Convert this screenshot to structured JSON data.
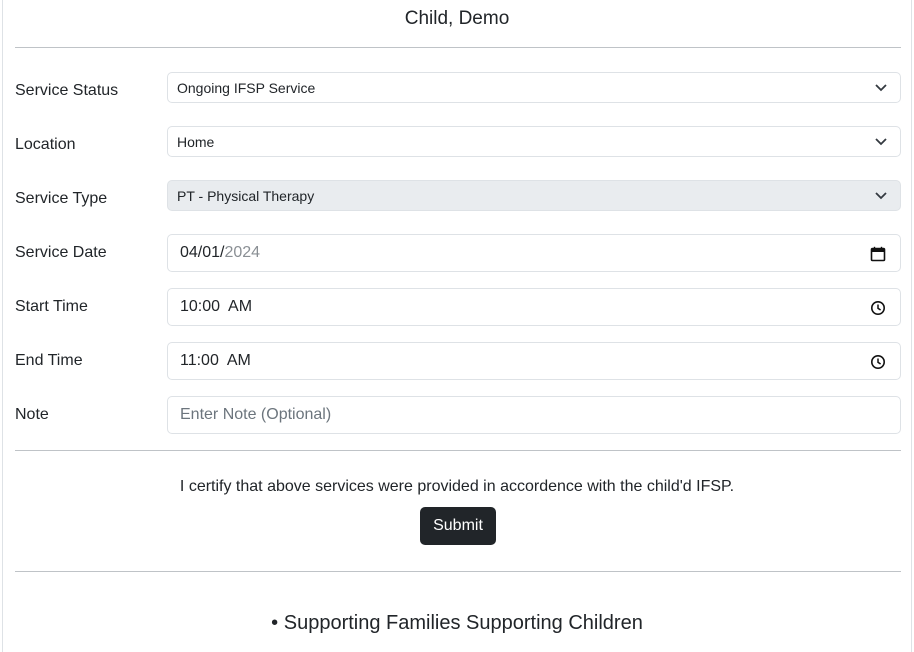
{
  "header": {
    "title": "Child, Demo"
  },
  "form": {
    "service_status": {
      "label": "Service Status",
      "value": "Ongoing IFSP Service"
    },
    "location": {
      "label": "Location",
      "value": "Home"
    },
    "service_type": {
      "label": "Service Type",
      "value": "PT - Physical Therapy"
    },
    "service_date": {
      "label": "Service Date",
      "value_mmdd": "04/01/",
      "value_year": "2024"
    },
    "start_time": {
      "label": "Start Time",
      "value": "10:00  AM"
    },
    "end_time": {
      "label": "End Time",
      "value": "11:00  AM"
    },
    "note": {
      "label": "Note",
      "placeholder": "Enter Note (Optional)"
    }
  },
  "certification": {
    "text": "I certify that above services were provided in accordence with the child'd IFSP.",
    "submit_label": "Submit"
  },
  "footer": {
    "text": "• Supporting Families Supporting Children"
  }
}
